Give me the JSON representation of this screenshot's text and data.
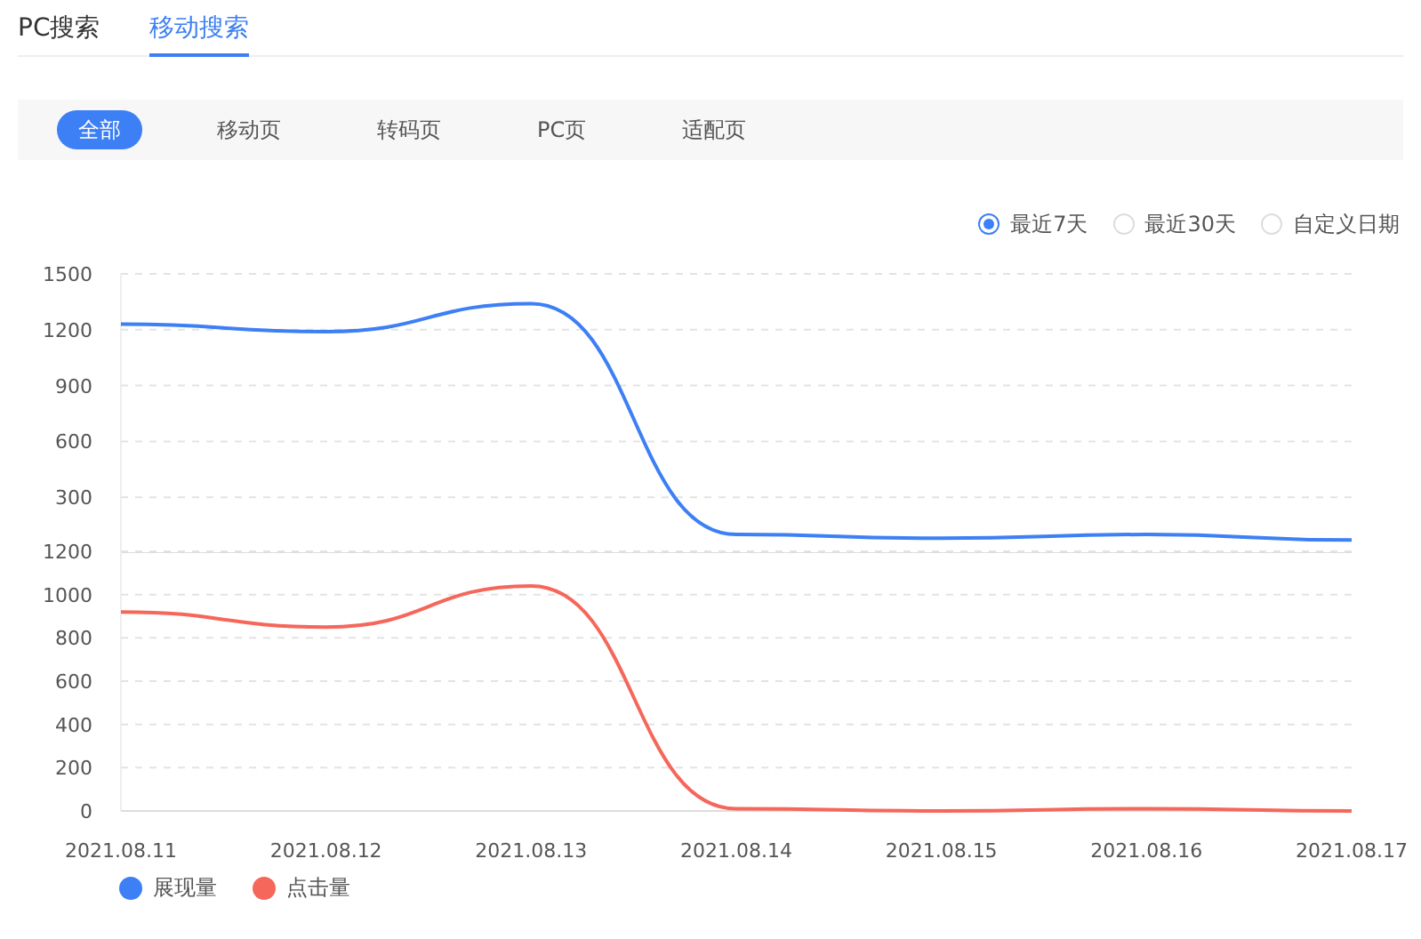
{
  "tabs": [
    {
      "label": "PC搜索",
      "selected": false
    },
    {
      "label": "移动搜索",
      "selected": true
    }
  ],
  "filters": [
    {
      "label": "全部",
      "selected": true
    },
    {
      "label": "移动页",
      "selected": false
    },
    {
      "label": "转码页",
      "selected": false
    },
    {
      "label": "PC页",
      "selected": false
    },
    {
      "label": "适配页",
      "selected": false
    }
  ],
  "date_range": [
    {
      "label": "最近7天",
      "selected": true
    },
    {
      "label": "最近30天",
      "selected": false
    },
    {
      "label": "自定义日期",
      "selected": false
    }
  ],
  "charts": [
    {
      "chart_data": {
        "type": "line",
        "ylim": [
          0,
          1500
        ],
        "yticks": [
          300,
          600,
          900,
          1200,
          1500
        ],
        "grid": true,
        "series": [
          {
            "name": "展现量",
            "color": "#3d7ff5",
            "values": [
              1230,
              1190,
              1340,
              100,
              80,
              100,
              70
            ]
          }
        ]
      }
    },
    {
      "chart_data": {
        "type": "line",
        "categories": [
          "2021.08.11",
          "2021.08.12",
          "2021.08.13",
          "2021.08.14",
          "2021.08.15",
          "2021.08.16",
          "2021.08.17"
        ],
        "ylim": [
          0,
          1200
        ],
        "yticks": [
          0,
          200,
          400,
          600,
          800,
          1000,
          1200
        ],
        "grid": true,
        "series": [
          {
            "name": "点击量",
            "color": "#f5675a",
            "values": [
              920,
              850,
              1040,
              10,
              0,
              10,
              0
            ]
          }
        ]
      }
    }
  ]
}
